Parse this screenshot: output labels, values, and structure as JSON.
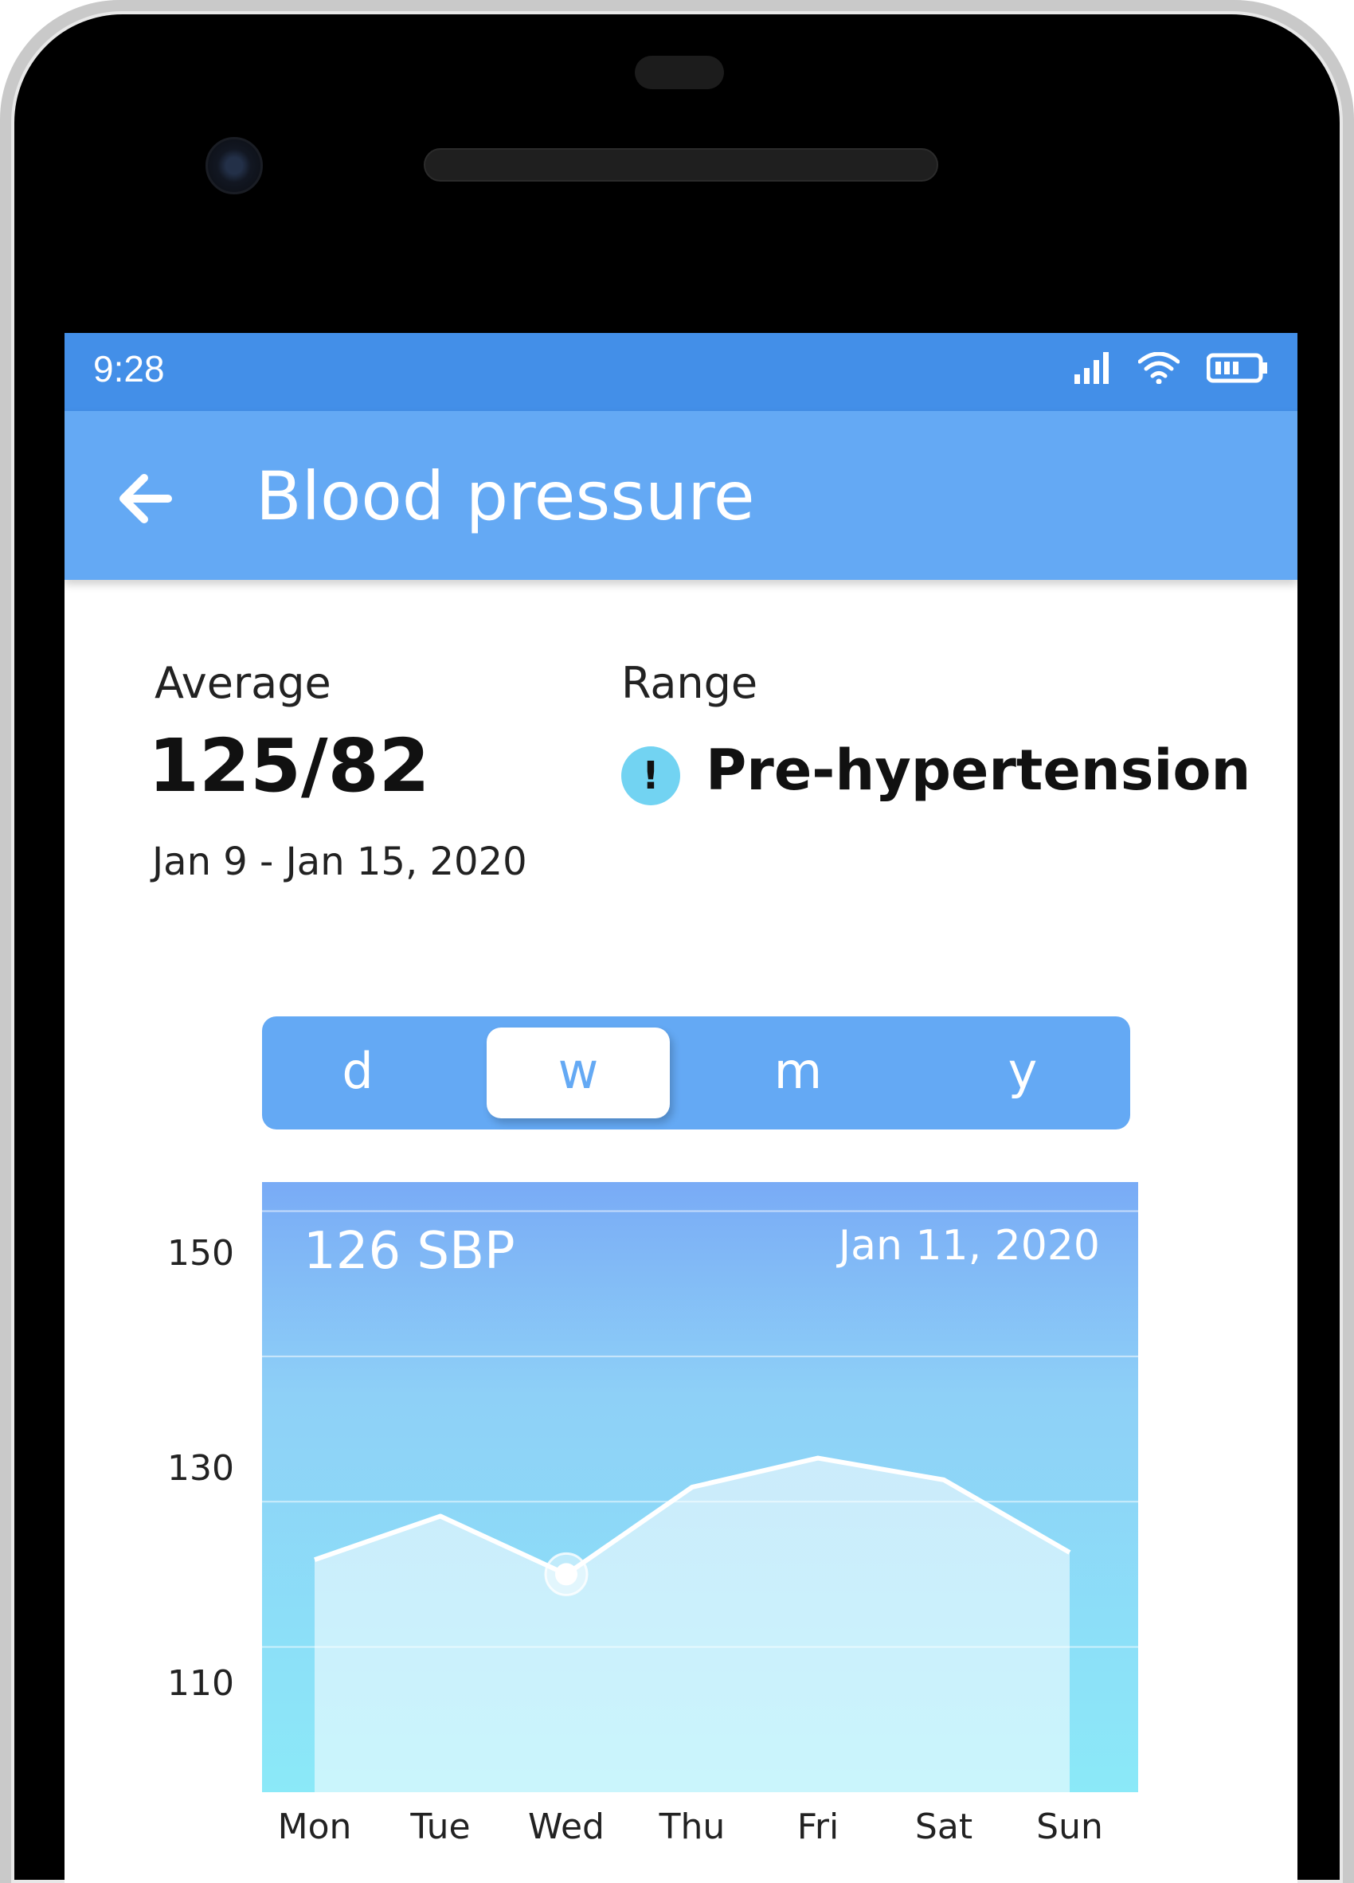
{
  "status_bar": {
    "time": "9:28",
    "icons": [
      "signal-icon",
      "wifi-icon",
      "battery-icon"
    ]
  },
  "app_bar": {
    "back_icon": "arrow-left-icon",
    "title": "Blood pressure"
  },
  "summary": {
    "average_label": "Average",
    "average_value": "125/82",
    "date_range": "Jan 9 - Jan 15, 2020",
    "range_label": "Range",
    "range_value": "Pre-hypertension",
    "range_icon": "exclamation-icon",
    "range_icon_glyph": "!"
  },
  "period_tabs": [
    {
      "label": "d",
      "active": false
    },
    {
      "label": "w",
      "active": true
    },
    {
      "label": "m",
      "active": false
    },
    {
      "label": "y",
      "active": false
    }
  ],
  "chart_header": {
    "value": "126 SBP",
    "date": "Jan 11, 2020"
  },
  "colors": {
    "status_bar": "#438fe8",
    "app_bar": "#64a9f4",
    "alert": "#72d3f2"
  },
  "chart_data": {
    "type": "area",
    "categories": [
      "Mon",
      "Tue",
      "Wed",
      "Thu",
      "Fri",
      "Sat",
      "Sun"
    ],
    "values": [
      126,
      129,
      125,
      131,
      133,
      131.5,
      126.5
    ],
    "y_ticks": [
      "150",
      "130",
      "110"
    ],
    "ylim": [
      110,
      152
    ],
    "selected_index": 2
  }
}
